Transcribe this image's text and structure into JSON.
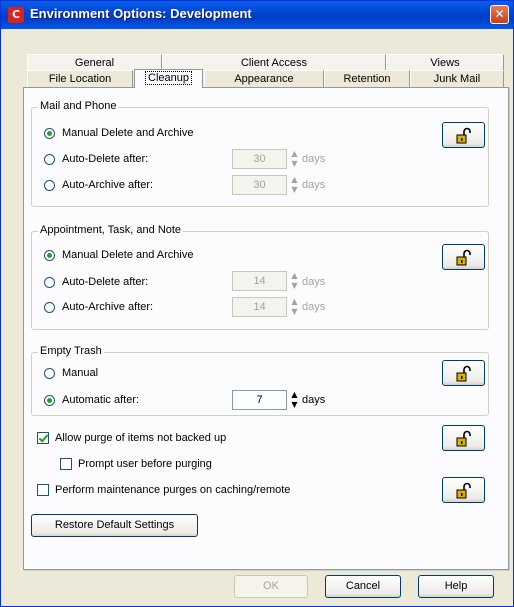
{
  "window": {
    "title": "Environment Options:  Development",
    "close_glyph": "✕"
  },
  "tabs": {
    "back_row": [
      "General",
      "Client Access",
      "Views"
    ],
    "front_row": [
      "File Location",
      "Cleanup",
      "Appearance",
      "Retention",
      "Junk Mail"
    ],
    "active": "Cleanup"
  },
  "groups": {
    "mail": {
      "title": "Mail and Phone",
      "options": [
        "Manual Delete and Archive",
        "Auto-Delete after:",
        "Auto-Archive after:"
      ],
      "selected": 0,
      "delete_days": "30",
      "archive_days": "30"
    },
    "appointment": {
      "title": "Appointment, Task, and Note",
      "options": [
        "Manual Delete and Archive",
        "Auto-Delete after:",
        "Auto-Archive after:"
      ],
      "selected": 0,
      "delete_days": "14",
      "archive_days": "14"
    },
    "trash": {
      "title": "Empty Trash",
      "options": [
        "Manual",
        "Automatic after:"
      ],
      "selected": 1,
      "days": "7"
    }
  },
  "units": "days",
  "checkboxes": {
    "allow_purge": {
      "label": "Allow purge of items not backed up",
      "checked": true
    },
    "prompt_user": {
      "label": "Prompt user before purging",
      "checked": false
    },
    "maintenance": {
      "label": "Perform maintenance purges on caching/remote",
      "checked": false
    }
  },
  "buttons": {
    "restore": "Restore Default Settings",
    "ok": "OK",
    "cancel": "Cancel",
    "help": "Help"
  },
  "icons": {
    "title": "groupwise-app-icon",
    "lock": "unlocked-padlock-icon",
    "spin_up": "▲",
    "spin_down": "▼"
  },
  "colors": {
    "titlebar": "#0043d3",
    "dialog_bg": "#ece9d8",
    "panel_bg": "#fcfcfe",
    "lock_icon": "#d9b200",
    "radio_dot": "#21a121"
  }
}
